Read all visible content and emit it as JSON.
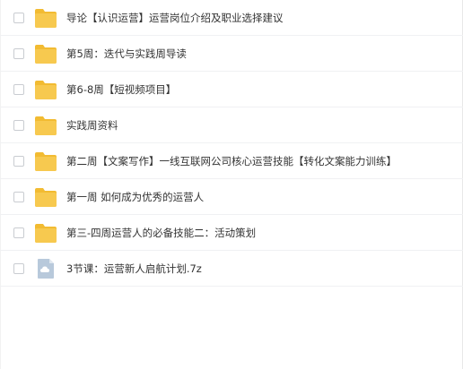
{
  "files": [
    {
      "name": "导论【认识运营】运营岗位介绍及职业选择建议",
      "type": "folder"
    },
    {
      "name": "第5周：迭代与实践周导读",
      "type": "folder"
    },
    {
      "name": "第6-8周【短视频项目】",
      "type": "folder"
    },
    {
      "name": "实践周资料",
      "type": "folder"
    },
    {
      "name": "第二周【文案写作】一线互联网公司核心运营技能【转化文案能力训练】",
      "type": "folder"
    },
    {
      "name": "第一周 如何成为优秀的运营人",
      "type": "folder"
    },
    {
      "name": "第三-四周运营人的必备技能二：活动策划",
      "type": "folder"
    },
    {
      "name": "3节课：运营新人启航计划.7z",
      "type": "archive"
    }
  ],
  "colors": {
    "folder": "#f7c94f",
    "folder_tab": "#f2bb32",
    "archive": "#b8c9db",
    "text": "#333333"
  }
}
